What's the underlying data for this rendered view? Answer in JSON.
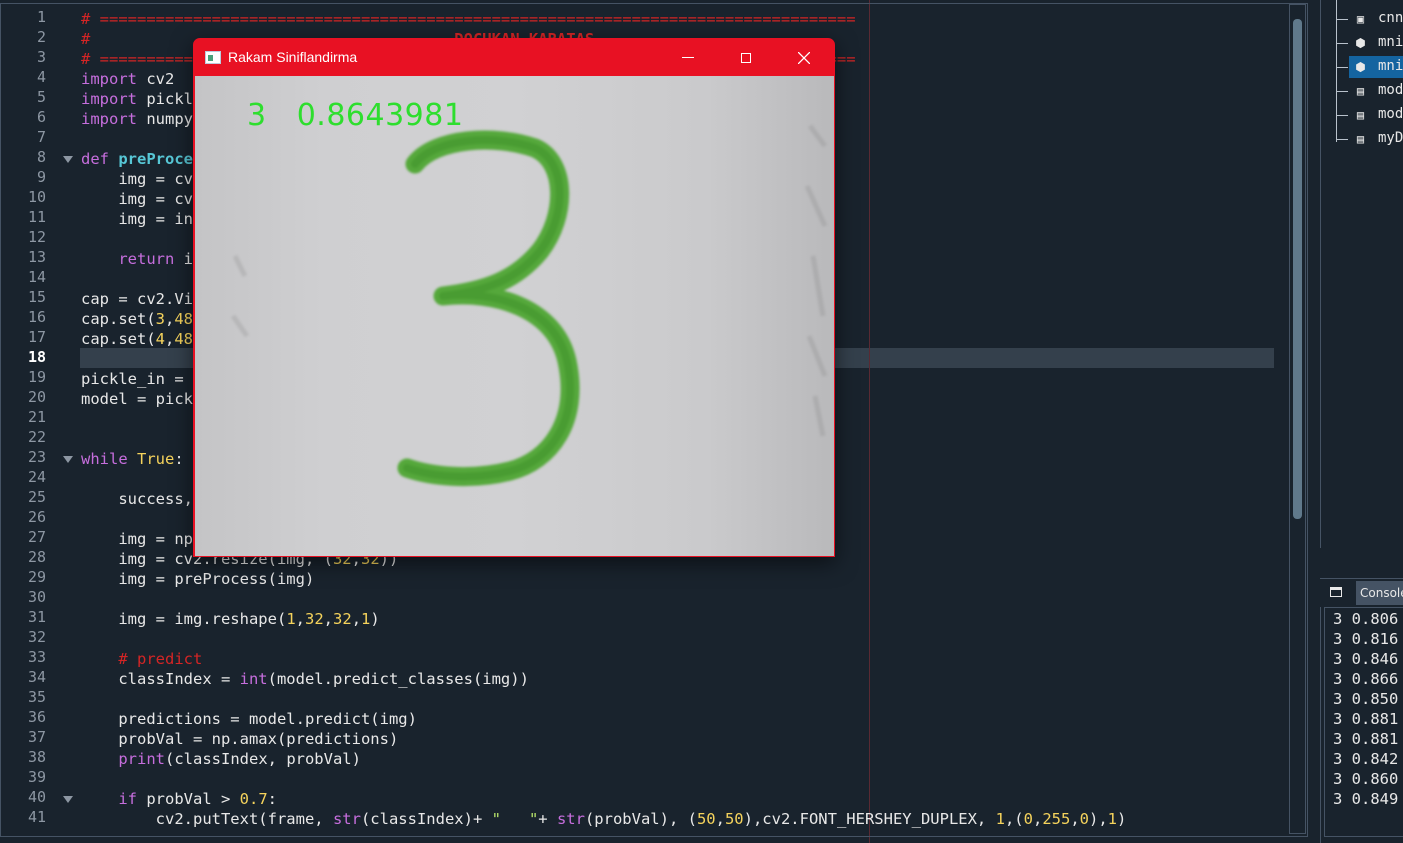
{
  "editor": {
    "current_line": "18",
    "lines": [
      {
        "n": "1",
        "html": "<span class=\"cm\"># =================================================================================</span>"
      },
      {
        "n": "2",
        "html": "<span class=\"cm\">#                                       </span><span class=\"cmb\">DOCUKAN KARATAS</span>"
      },
      {
        "n": "3",
        "html": "<span class=\"cm\"># =================================================================================</span>"
      },
      {
        "n": "4",
        "html": "<span class=\"kw\">import</span> cv2"
      },
      {
        "n": "5",
        "html": "<span class=\"kw\">import</span> pickle"
      },
      {
        "n": "6",
        "html": "<span class=\"kw\">import</span> numpy"
      },
      {
        "n": "7",
        "html": ""
      },
      {
        "n": "8",
        "html": "<span class=\"kw\">def</span> <span class=\"fn\">preProcess</span>"
      },
      {
        "n": "9",
        "html": "    img = cv"
      },
      {
        "n": "10",
        "html": "    img = cv"
      },
      {
        "n": "11",
        "html": "    img = in"
      },
      {
        "n": "12",
        "html": ""
      },
      {
        "n": "13",
        "html": "    <span class=\"kw\">return</span> img"
      },
      {
        "n": "14",
        "html": ""
      },
      {
        "n": "15",
        "html": "cap = cv2.Vi"
      },
      {
        "n": "16",
        "html": "cap.set(<span class=\"num\">3</span>,<span class=\"num\">48</span>"
      },
      {
        "n": "17",
        "html": "cap.set(<span class=\"num\">4</span>,<span class=\"num\">48</span>"
      },
      {
        "n": "18",
        "html": ""
      },
      {
        "n": "19",
        "html": "pickle_in = "
      },
      {
        "n": "20",
        "html": "model = pick"
      },
      {
        "n": "21",
        "html": ""
      },
      {
        "n": "22",
        "html": ""
      },
      {
        "n": "23",
        "html": "<span class=\"kw\">while</span> <span class=\"tr\">True</span>:"
      },
      {
        "n": "24",
        "html": ""
      },
      {
        "n": "25",
        "html": "    success, "
      },
      {
        "n": "26",
        "html": ""
      },
      {
        "n": "27",
        "html": "    img = np"
      },
      {
        "n": "28",
        "html": "    img = cv2.resize(img, (<span class=\"num\">32</span>,<span class=\"num\">32</span>))"
      },
      {
        "n": "29",
        "html": "    img = preProcess(img)"
      },
      {
        "n": "30",
        "html": ""
      },
      {
        "n": "31",
        "html": "    img = img.reshape(<span class=\"num\">1</span>,<span class=\"num\">32</span>,<span class=\"num\">32</span>,<span class=\"num\">1</span>)"
      },
      {
        "n": "32",
        "html": ""
      },
      {
        "n": "33",
        "html": "    <span class=\"cm\"># predict</span>"
      },
      {
        "n": "34",
        "html": "    classIndex = <span class=\"bi\">int</span>(model.predict_classes(img))"
      },
      {
        "n": "35",
        "html": ""
      },
      {
        "n": "36",
        "html": "    predictions = model.predict(img)"
      },
      {
        "n": "37",
        "html": "    probVal = np.amax(predictions)"
      },
      {
        "n": "38",
        "html": "    <span class=\"bi\">print</span>(classIndex, probVal)"
      },
      {
        "n": "39",
        "html": ""
      },
      {
        "n": "40",
        "html": "    <span class=\"kw\">if</span> probVal &gt; <span class=\"num\">0.7</span>:"
      },
      {
        "n": "41",
        "html": "        cv2.putText(frame, <span class=\"bi\">str</span>(classIndex)+ <span class=\"str\">\"   \"</span>+ <span class=\"bi\">str</span>(probVal), (<span class=\"num\">50</span>,<span class=\"num\">50</span>),cv2.FONT_HERSHEY_DUPLEX, <span class=\"num\">1</span>,(<span class=\"num\">0</span>,<span class=\"num\">255</span>,<span class=\"num\">0</span>),<span class=\"num\">1</span>)"
      }
    ],
    "fold_lines": [
      "8",
      "23",
      "40"
    ]
  },
  "file_explorer": {
    "items": [
      {
        "label": "cnn.",
        "icon": "image-file-icon",
        "glyph": "▣",
        "selected": false
      },
      {
        "label": "mnis",
        "icon": "python-file-icon",
        "glyph": "⬢",
        "selected": false
      },
      {
        "label": "mnis",
        "icon": "python-file-icon",
        "glyph": "⬢",
        "selected": true
      },
      {
        "label": "mod",
        "icon": "binary-file-icon",
        "glyph": "▤",
        "selected": false
      },
      {
        "label": "mod",
        "icon": "binary-file-icon",
        "glyph": "▤",
        "selected": false
      },
      {
        "label": "myD",
        "icon": "binary-file-icon",
        "glyph": "▤",
        "selected": false
      }
    ]
  },
  "console": {
    "tab_label": "Console",
    "lines": [
      "3 0.806",
      "3 0.816",
      "3 0.846",
      "3 0.866",
      "3 0.850",
      "3 0.881",
      "3 0.881",
      "3 0.842",
      "3 0.860",
      "3 0.849"
    ]
  },
  "camera_window": {
    "title": "Rakam Siniflandirma",
    "overlay_class": "3",
    "overlay_prob": "0.8643981",
    "overlay_separator": "   ",
    "overlay_color": "#2ede2e",
    "title_bar_color": "#e81123"
  }
}
